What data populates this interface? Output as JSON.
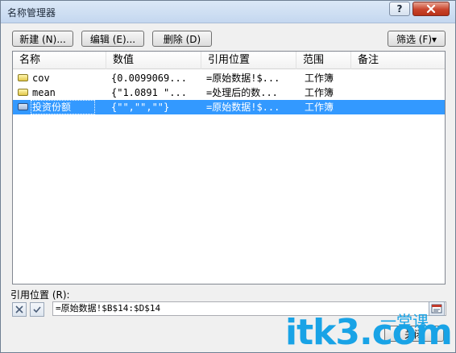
{
  "window": {
    "title": "名称管理器"
  },
  "titlebar": {
    "help_label": "?",
    "close_label": "✕"
  },
  "toolbar": {
    "new_label": "新建 (N)...",
    "edit_label": "编辑 (E)...",
    "delete_label": "删除 (D)",
    "filter_label": "筛选 (F)▾"
  },
  "table": {
    "columns": [
      "名称",
      "数值",
      "引用位置",
      "范围",
      "备注"
    ],
    "rows": [
      {
        "name": "cov",
        "value": "{0.0099069...",
        "ref": "=原始数据!$...",
        "scope": "工作簿",
        "note": ""
      },
      {
        "name": "mean",
        "value": "{\"1.0891 \"...",
        "ref": "=处理后的数...",
        "scope": "工作簿",
        "note": ""
      },
      {
        "name": "投资份额",
        "value": "{\"\",\"\",\"\"}",
        "ref": "=原始数据!$...",
        "scope": "工作簿",
        "note": ""
      }
    ],
    "selected_index": 2
  },
  "reference": {
    "label": "引用位置 (R):",
    "value": "=原始数据!$B$14:$D$14"
  },
  "footer": {
    "close_label": "关闭"
  },
  "watermark": {
    "main": "itk3.com",
    "sub": "一堂课"
  },
  "colors": {
    "selection": "#3399ff",
    "title_bg": "#c4d7ef",
    "watermark": "#19a3e6"
  }
}
